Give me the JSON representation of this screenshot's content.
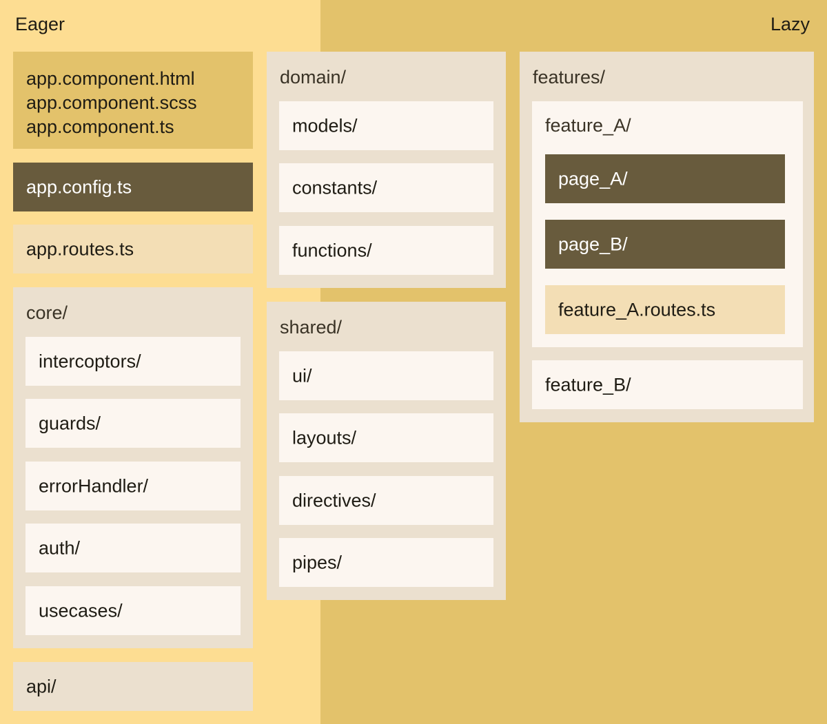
{
  "zones": {
    "eager": "Eager",
    "lazy": "Lazy"
  },
  "app_component_files": [
    "app.component.html",
    "app.component.scss",
    "app.component.ts"
  ],
  "app_config": "app.config.ts",
  "app_routes": "app.routes.ts",
  "core": {
    "title": "core/",
    "items": [
      "intercoptors/",
      "guards/",
      "errorHandler/",
      "auth/",
      "usecases/"
    ]
  },
  "api": "api/",
  "domain": {
    "title": "domain/",
    "items": [
      "models/",
      "constants/",
      "functions/"
    ]
  },
  "shared": {
    "title": "shared/",
    "items": [
      "ui/",
      "layouts/",
      "directives/",
      "pipes/"
    ]
  },
  "features": {
    "title": "features/",
    "feature_a": {
      "title": "feature_A/",
      "page_a": "page_A/",
      "page_b": "page_B/",
      "routes": "feature_A.routes.ts"
    },
    "feature_b": "feature_B/"
  },
  "colors": {
    "eager_bg": "#fddd92",
    "lazy_bg": "#e3c26b",
    "dark": "#685b3d",
    "group": "#ebe0cf",
    "item": "#fcf6f0",
    "sand": "#f3deb5"
  }
}
